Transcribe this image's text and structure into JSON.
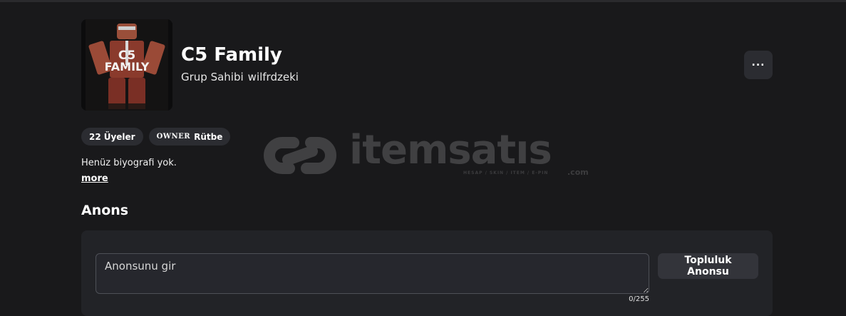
{
  "group": {
    "name": "C5 Family",
    "owner_label": "Grup Sahibi",
    "owner_name": "wilfrdzeki",
    "avatar_text_line1": "C5",
    "avatar_text_line2": "FAMILY"
  },
  "pills": {
    "members_count": "22",
    "members_label": "Üyeler",
    "rank_tag": "OWNER",
    "rank_label": "Rütbe"
  },
  "bio": {
    "text": "Henüz biyografi yok.",
    "more_label": "more"
  },
  "announcement": {
    "section_title": "Anons",
    "placeholder": "Anonsunu gir",
    "counter": "0/255",
    "submit_label": "Topluluk Anonsu"
  },
  "more_menu": {
    "icon": "ellipsis-icon",
    "glyph": "..."
  },
  "watermark": {
    "brand": "itemsatıs",
    "tagline": "HESAP / SKIN / ITEM / E-PIN",
    "suffix": ".com"
  },
  "colors": {
    "background": "#19191b",
    "panel": "#222327",
    "pill": "#2b2c31",
    "input_border": "#4e5057"
  }
}
